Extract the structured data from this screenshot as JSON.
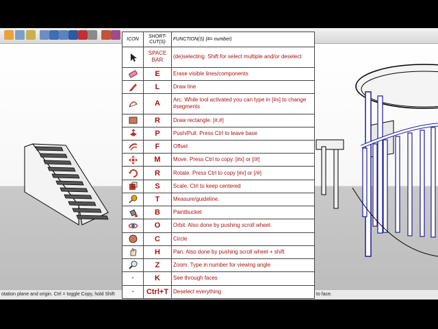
{
  "status": {
    "left": "otation plane and origin.  Ctrl = toggle Copy, hold Shift",
    "right": "to face."
  },
  "table": {
    "headers": {
      "icon": "ICON",
      "shortcut": "SHORT-CUT(S)",
      "function": "FUNCTION(S) (#= number)"
    },
    "rows": [
      {
        "icon": "select-arrow-icon",
        "key": "SPACE BAR",
        "func": "(de)selecting. Shift for select multiple and/or deselect"
      },
      {
        "icon": "eraser-icon",
        "key": "E",
        "func": "Erase visible lines/components"
      },
      {
        "icon": "pencil-icon",
        "key": "L",
        "func": "Draw line"
      },
      {
        "icon": "arc-icon",
        "key": "A",
        "func": "Arc. While tool activated you can type in [#s] to change #segments"
      },
      {
        "icon": "rectangle-icon",
        "key": "R",
        "func": "Draw rectangle. [#,#]"
      },
      {
        "icon": "push-pull-icon",
        "key": "P",
        "func": "Push/Pull. Press Ctrl to leave base"
      },
      {
        "icon": "offset-icon",
        "key": "F",
        "func": "Offset"
      },
      {
        "icon": "move-icon",
        "key": "M",
        "func": "Move. Press Ctrl to copy. [#x] or [/#]"
      },
      {
        "icon": "rotate-icon",
        "key": "R",
        "func": "Rotate. Press Ctrl to copy [#x] or [/#]"
      },
      {
        "icon": "scale-icon",
        "key": "S",
        "func": "Scale. Ctrl to keep centered"
      },
      {
        "icon": "tape-measure-icon",
        "key": "T",
        "func": "Measure/guideline."
      },
      {
        "icon": "paint-bucket-icon",
        "key": "B",
        "func": "Paintbucket"
      },
      {
        "icon": "orbit-icon",
        "key": "O",
        "func": "Orbit. Also done by pushing scroll wheel."
      },
      {
        "icon": "circle-icon",
        "key": "C",
        "func": "Circle"
      },
      {
        "icon": "pan-hand-icon",
        "key": "H",
        "func": "Pan. Also done by pushing scroll wheel + shift"
      },
      {
        "icon": "zoom-icon",
        "key": "Z",
        "func": "Zoom. Type in number for viewing angle"
      },
      {
        "icon": "-",
        "key": "K",
        "func": "See through faces"
      },
      {
        "icon": "-",
        "key": "Ctrl+T",
        "func": "Deselect everything"
      }
    ]
  }
}
